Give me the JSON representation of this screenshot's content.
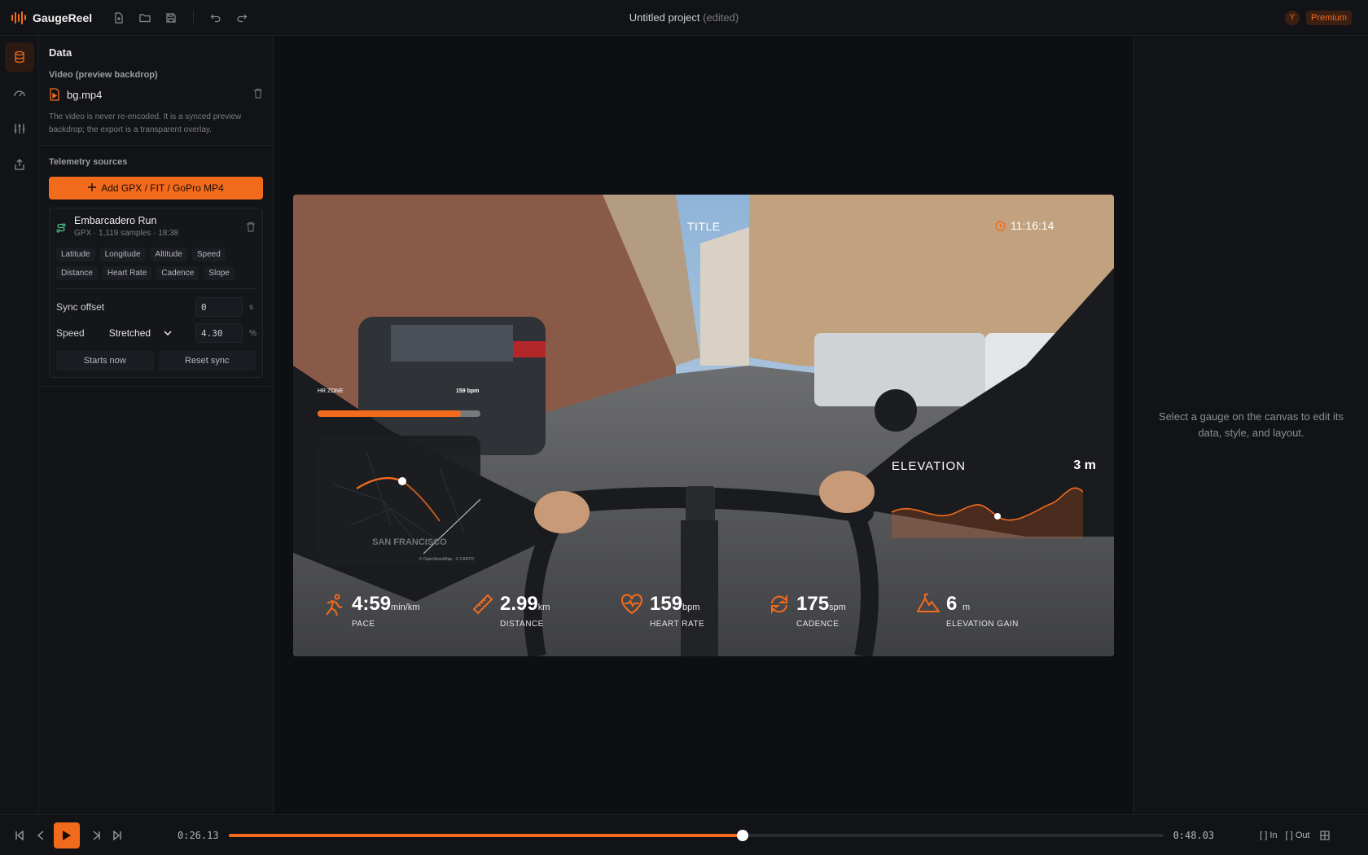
{
  "app": {
    "name": "GaugeReel",
    "project_title": "Untitled project",
    "project_state": "(edited)",
    "avatar_initial": "Y",
    "plan_badge": "Premium"
  },
  "panel": {
    "title": "Data",
    "video_section": "Video (preview backdrop)",
    "video_file": "bg.mp4",
    "video_note": "The video is never re-encoded. It is a synced preview backdrop; the export is a transparent overlay.",
    "telemetry_section": "Telemetry sources",
    "add_button": "Add GPX / FIT / GoPro MP4",
    "source": {
      "name": "Embarcadero Run",
      "meta": "GPX · 1,119 samples · 18:38",
      "tags": [
        "Latitude",
        "Longitude",
        "Altitude",
        "Speed",
        "Distance",
        "Heart Rate",
        "Cadence",
        "Slope"
      ],
      "sync_offset_label": "Sync offset",
      "sync_offset_value": "0",
      "sync_offset_unit": "s",
      "speed_label": "Speed",
      "speed_mode": "Stretched",
      "speed_value": "4.30",
      "speed_unit": "%",
      "starts_now": "Starts now",
      "reset_sync": "Reset sync"
    }
  },
  "overlay": {
    "title": "TITLE",
    "clock": "11:16:14",
    "hr_zone_label": "HR ZONE",
    "hr_zone_value": "159 bpm",
    "hr_zone_fraction": 0.88,
    "map_label": "SAN FRANCISCO",
    "map_attribution": "© OpenStreetMap · © CARTO",
    "elevation_label": "ELEVATION",
    "elevation_value": "3 m",
    "stats": [
      {
        "value": "4:59",
        "unit": "min/km",
        "label": "PACE",
        "icon": "runner-icon"
      },
      {
        "value": "2.99",
        "unit": "km",
        "label": "DISTANCE",
        "icon": "ruler-icon"
      },
      {
        "value": "159",
        "unit": "bpm",
        "label": "HEART RATE",
        "icon": "heart-pulse-icon"
      },
      {
        "value": "175",
        "unit": "spm",
        "label": "CADENCE",
        "icon": "cycle-icon"
      },
      {
        "value": "6",
        "unit": "m",
        "label": "ELEVATION GAIN",
        "icon": "mountain-icon"
      }
    ]
  },
  "right_panel": {
    "hint": "Select a gauge on the canvas to edit its data, style, and layout."
  },
  "playback": {
    "current": "0:26.13",
    "total": "0:48.03",
    "progress": 0.55,
    "in_label": "In",
    "out_label": "Out"
  },
  "colors": {
    "accent": "#f26b1d",
    "background": "#0e0f12",
    "panel": "#121316"
  }
}
